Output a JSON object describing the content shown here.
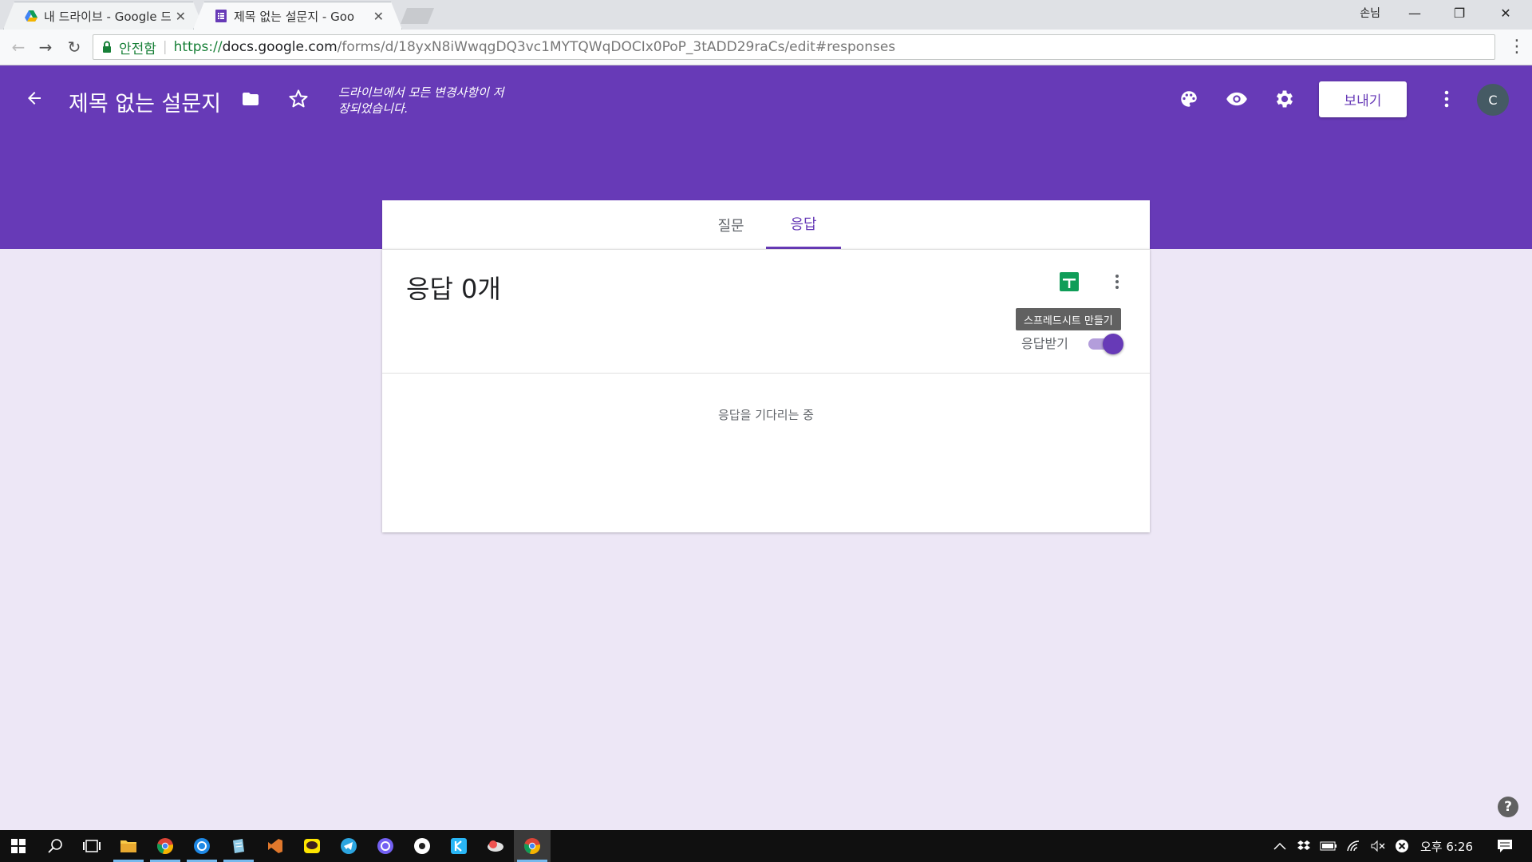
{
  "browser": {
    "tabs": [
      {
        "title": "내 드라이브 - Google 드",
        "favicon": "google-drive-icon"
      },
      {
        "title": "제목 없는 설문지 - Goo",
        "favicon": "google-forms-icon"
      }
    ],
    "user_label": "손님",
    "security_label": "안전함",
    "url_https": "https://",
    "url_host": "docs.google.com",
    "url_path": "/forms/d/18yxN8iWwqgDQ3vc1MYTQWqDOCIx0PoP_3tADD29raCs/edit#responses"
  },
  "header": {
    "title": "제목 없는 설문지",
    "save_status": "드라이브에서 모든 변경사항이 저장되었습니다.",
    "send_label": "보내기",
    "avatar_letter": "C",
    "color": "#673ab7"
  },
  "form_tabs": [
    {
      "label": "질문",
      "active": false
    },
    {
      "label": "응답",
      "active": true
    }
  ],
  "responses": {
    "count_title": "응답 0개",
    "tooltip": "스프레드시트 만들기",
    "accept_label": "응답받기",
    "accepting": true,
    "waiting_text": "응답을 기다리는 중"
  },
  "taskbar": {
    "apps": [
      "start-icon",
      "search-icon",
      "task-view-icon",
      "file-explorer-icon",
      "chrome-icon",
      "app-blue-icon",
      "notepad-icon",
      "visual-studio-icon",
      "kakaotalk-icon",
      "telegram-icon",
      "viber-icon",
      "app-dot-icon",
      "kite-icon",
      "app-cloud-icon",
      "chrome-active-icon"
    ],
    "time": "오후 6:26"
  }
}
